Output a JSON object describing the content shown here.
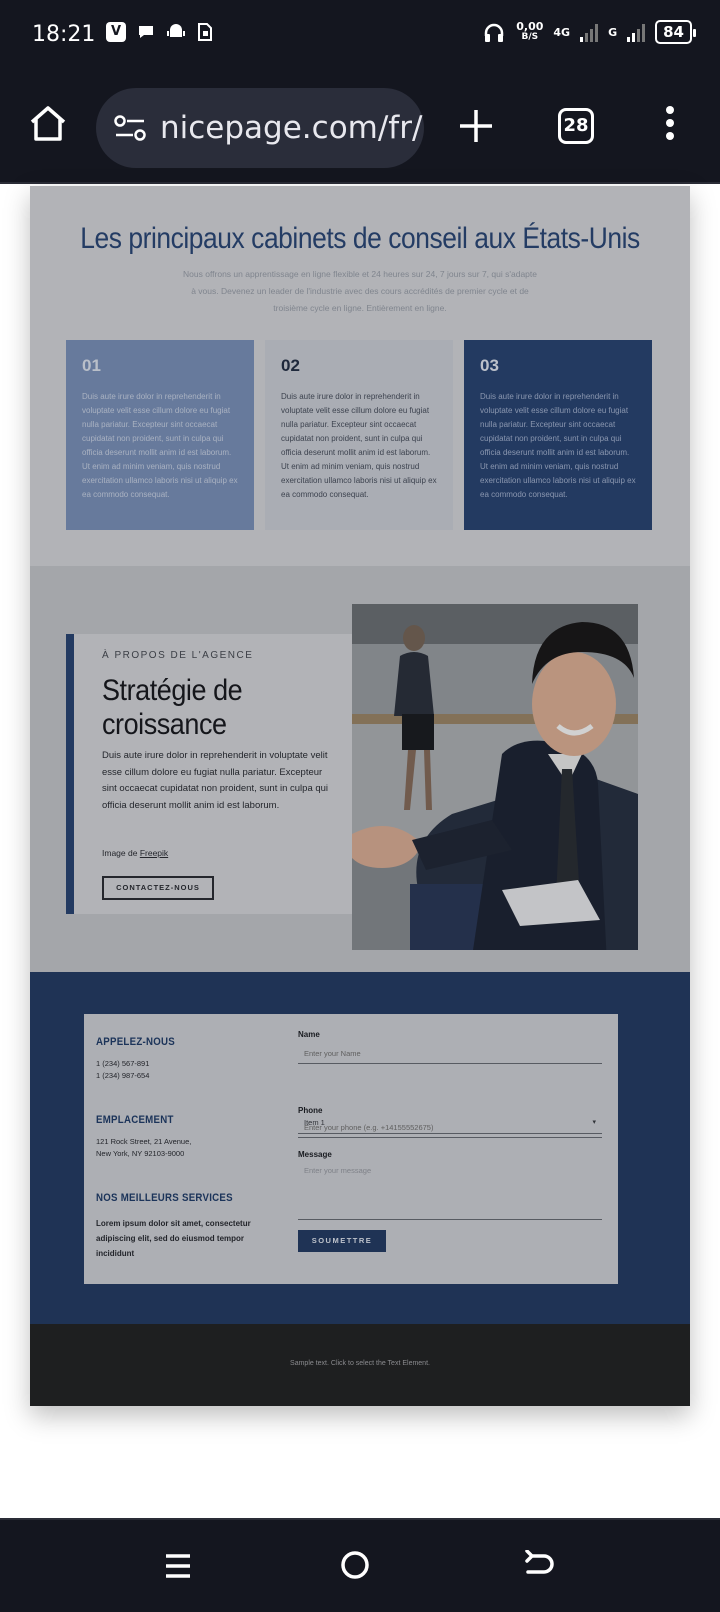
{
  "status_bar": {
    "time": "18:21",
    "app_icons": [
      "V",
      "•",
      "•",
      "•"
    ],
    "net_speed_value": "0,00",
    "net_speed_unit": "B/S",
    "net_type_1": "4G",
    "net_type_2": "G",
    "battery": "84"
  },
  "browser": {
    "url": "nicepage.com/fr/",
    "tab_count": "28"
  },
  "section1": {
    "title": "Les principaux cabinets de conseil aux États-Unis",
    "subtitle": "Nous offrons un apprentissage en ligne flexible et 24 heures sur 24, 7 jours sur 7, qui s'adapte à vous. Devenez un leader de l'industrie avec des cours accrédités de premier cycle et de troisième cycle en ligne. Entièrement en ligne.",
    "cards": [
      {
        "num": "01",
        "text": "Duis aute irure dolor in reprehenderit in voluptate velit esse cillum dolore eu fugiat nulla pariatur. Excepteur sint occaecat cupidatat non proident, sunt in culpa qui officia deserunt mollit anim id est laborum.\nUt enim ad minim veniam, quis nostrud exercitation ullamco laboris nisi ut aliquip ex ea commodo consequat."
      },
      {
        "num": "02",
        "text": "Duis aute irure dolor in reprehenderit in voluptate velit esse cillum dolore eu fugiat nulla pariatur. Excepteur sint occaecat cupidatat non proident, sunt in culpa qui officia deserunt mollit anim id est laborum.\nUt enim ad minim veniam, quis nostrud exercitation ullamco laboris nisi ut aliquip ex ea commodo consequat."
      },
      {
        "num": "03",
        "text": "Duis aute irure dolor in reprehenderit in voluptate velit esse cillum dolore eu fugiat nulla pariatur. Excepteur sint occaecat cupidatat non proident, sunt in culpa qui officia deserunt mollit anim id est laborum.\nUt enim ad minim veniam, quis nostrud exercitation ullamco laboris nisi ut aliquip ex ea commodo consequat."
      }
    ]
  },
  "section2": {
    "kicker": "À PROPOS DE L'AGENCE",
    "title": "Stratégie de croissance",
    "text": "Duis aute irure dolor in reprehenderit in voluptate velit esse cillum dolore eu fugiat nulla pariatur. Excepteur sint occaecat cupidatat non proident, sunt in culpa qui officia deserunt mollit anim id est laborum.",
    "credit_prefix": "Image de ",
    "credit_link": "Freepik",
    "button": "CONTACTEZ-NOUS"
  },
  "section3": {
    "call_heading": "APPELEZ-NOUS",
    "phone1": "1 (234) 567-891",
    "phone2": "1 (234) 987-654",
    "location_heading": "EMPLACEMENT",
    "address1": "121 Rock Street, 21 Avenue,",
    "address2": "New York, NY 92103-9000",
    "services_heading": "NOS MEILLEURS SERVICES",
    "services_text": "Lorem ipsum dolor sit amet, consectetur adipiscing elit, sed do eiusmod tempor incididunt",
    "form": {
      "name_label": "Name",
      "name_placeholder": "Enter your Name",
      "select_value": "Item 1",
      "phone_label": "Phone",
      "phone_placeholder": "Enter your phone (e.g. +14155552675)",
      "message_label": "Message",
      "message_placeholder": "Enter your message",
      "submit": "SOUMETTRE"
    }
  },
  "footer": {
    "text": "Sample text. Click to select the Text Element."
  },
  "colors": {
    "chrome": "#14161f",
    "brand_dark": "#2b4777",
    "brand_light": "#7e95bf",
    "footer": "#252628"
  }
}
